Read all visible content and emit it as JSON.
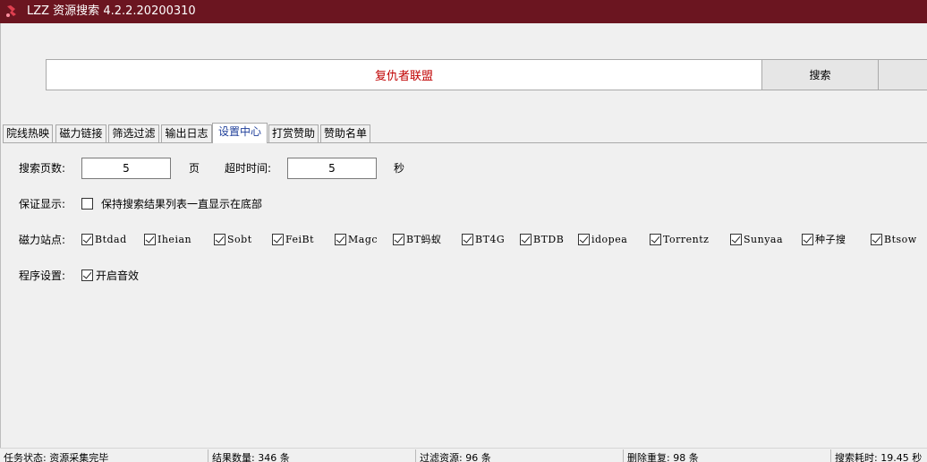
{
  "window": {
    "title": "LZZ 资源搜索 4.2.2.20200310",
    "icon": "app-icon"
  },
  "search": {
    "query": "复仇者联盟",
    "button_label": "搜索"
  },
  "tabs": [
    {
      "label": "院线热映"
    },
    {
      "label": "磁力链接"
    },
    {
      "label": "筛选过滤"
    },
    {
      "label": "输出日志"
    },
    {
      "label": "设置中心",
      "active": true
    },
    {
      "label": "打赏赞助"
    },
    {
      "label": "赞助名单"
    }
  ],
  "settings": {
    "pages_label": "搜索页数:",
    "pages_value": "5",
    "pages_unit": "页",
    "timeout_label": "超时时间:",
    "timeout_value": "5",
    "timeout_unit": "秒",
    "display_label": "保证显示:",
    "display_option": {
      "label": "保持搜索结果列表一直显示在底部",
      "checked": false
    },
    "sites_label": "磁力站点:",
    "sites": [
      {
        "label": "Btdad",
        "checked": true
      },
      {
        "label": "Iheian",
        "checked": true
      },
      {
        "label": "Sobt",
        "checked": true
      },
      {
        "label": "FeiBt",
        "checked": true
      },
      {
        "label": "Magc",
        "checked": true
      },
      {
        "label": "BT蚂蚁",
        "checked": true
      },
      {
        "label": "BT4G",
        "checked": true
      },
      {
        "label": "BTDB",
        "checked": true
      },
      {
        "label": "idopea",
        "checked": true
      },
      {
        "label": "Torrentz",
        "checked": true
      },
      {
        "label": "Sunyaa",
        "checked": true
      },
      {
        "label": "种子搜",
        "checked": true
      },
      {
        "label": "Btsow",
        "checked": true
      }
    ],
    "program_label": "程序设置:",
    "program_option": {
      "label": "开启音效",
      "checked": true
    }
  },
  "status": {
    "task": "任务状态: 资源采集完毕",
    "results": "结果数量: 346 条",
    "filtered": "过滤资源: 96 条",
    "dedup": "删除重复: 98 条",
    "time": "搜索耗时: 19.45 秒"
  },
  "colors": {
    "titlebar": "#6b1520",
    "query_text": "#c00000",
    "active_tab_text": "#1f3f9a"
  }
}
